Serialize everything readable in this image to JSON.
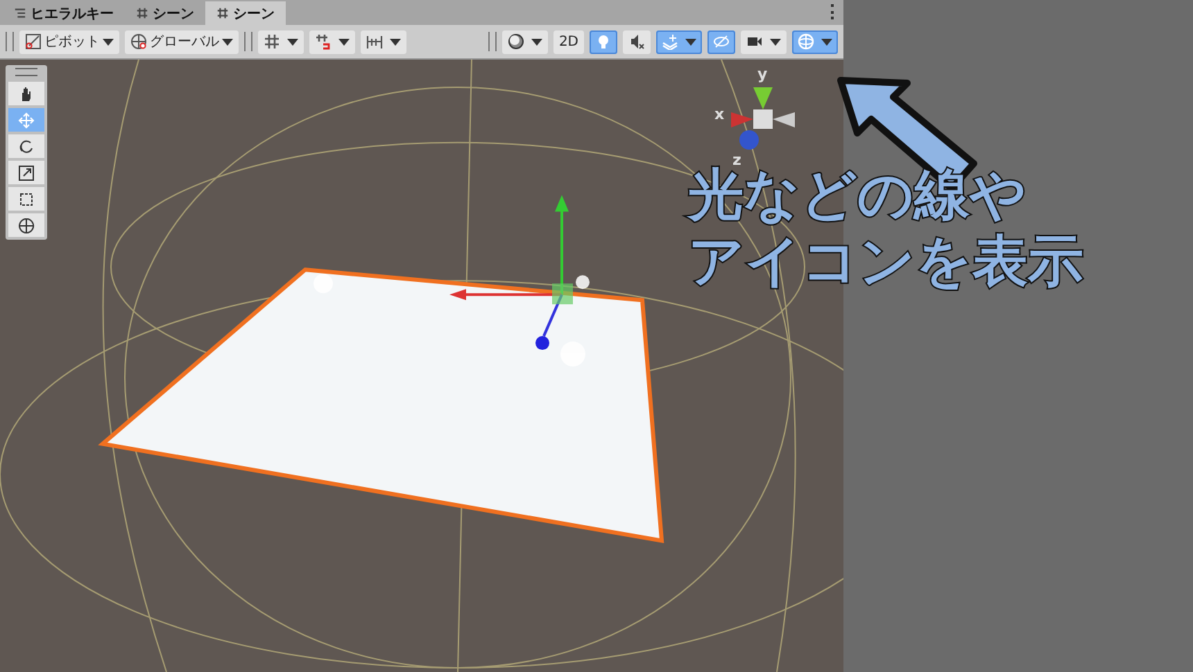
{
  "tabs": [
    {
      "label": "ヒエラルキー",
      "kind": "list",
      "selected": false
    },
    {
      "label": "シーン",
      "kind": "grid",
      "selected": false
    },
    {
      "label": "シーン",
      "kind": "grid",
      "selected": true
    }
  ],
  "toolbar": {
    "left": [
      {
        "kind": "pivot",
        "label": "ピボット"
      },
      {
        "kind": "global",
        "label": "グローバル"
      }
    ],
    "snap": [
      {
        "kind": "grid-snap",
        "dropdown": true
      },
      {
        "kind": "magnet",
        "dropdown": true
      },
      {
        "kind": "ruler",
        "dropdown": true
      }
    ],
    "right": [
      {
        "kind": "shading",
        "dropdown": true,
        "on": false
      },
      {
        "kind": "text",
        "label": "2D",
        "dropdown": false,
        "on": false
      },
      {
        "kind": "light",
        "dropdown": false,
        "on": true
      },
      {
        "kind": "audio",
        "dropdown": false,
        "on": false
      },
      {
        "kind": "effects",
        "dropdown": true,
        "on": true
      },
      {
        "kind": "hidden",
        "dropdown": false,
        "on": true
      },
      {
        "kind": "camera",
        "dropdown": true,
        "on": false
      },
      {
        "kind": "gizmos",
        "dropdown": true,
        "on": true
      }
    ]
  },
  "tools": [
    {
      "kind": "hand",
      "selected": false
    },
    {
      "kind": "move",
      "selected": true
    },
    {
      "kind": "rotate",
      "selected": false
    },
    {
      "kind": "scale",
      "selected": false
    },
    {
      "kind": "rect",
      "selected": false
    },
    {
      "kind": "transform",
      "selected": false
    }
  ],
  "axis_gizmo": {
    "y": "y",
    "x": "x",
    "z": "z"
  },
  "annotation": {
    "lines": [
      "光などの線や",
      "アイコンを表示"
    ]
  }
}
